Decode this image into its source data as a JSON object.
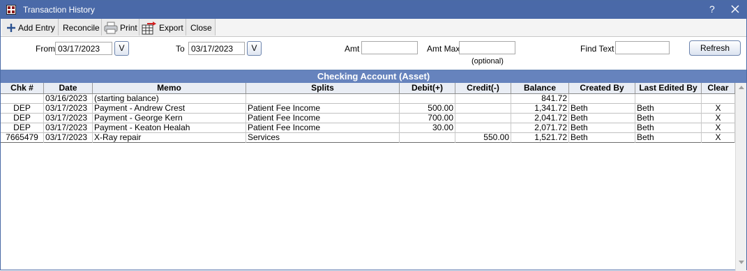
{
  "window": {
    "title": "Transaction History",
    "help_label": "?"
  },
  "toolbar": {
    "add_entry": "Add Entry",
    "reconcile": "Reconcile",
    "print": "Print",
    "export": "Export",
    "close": "Close"
  },
  "filters": {
    "from_label": "From",
    "from_value": "03/17/2023",
    "to_label": "To",
    "to_value": "03/17/2023",
    "v_label": "V",
    "amt_label": "Amt",
    "amt_value": "",
    "amt_max_label": "Amt Max",
    "amt_max_value": "",
    "optional_note": "(optional)",
    "find_text_label": "Find Text",
    "find_text_value": "",
    "refresh_label": "Refresh"
  },
  "grid": {
    "title": "Checking Account (Asset)",
    "columns": [
      "Chk #",
      "Date",
      "Memo",
      "Splits",
      "Debit(+)",
      "Credit(-)",
      "Balance",
      "Created By",
      "Last Edited By",
      "Clear"
    ],
    "rows": [
      [
        "",
        "03/16/2023",
        "(starting balance)",
        "",
        "",
        "",
        "841.72",
        "",
        "",
        ""
      ],
      [
        "DEP",
        "03/17/2023",
        "Payment - Andrew Crest",
        "Patient Fee Income",
        "500.00",
        "",
        "1,341.72",
        "Beth",
        "Beth",
        "X"
      ],
      [
        "DEP",
        "03/17/2023",
        "Payment - George Kern",
        "Patient Fee Income",
        "700.00",
        "",
        "2,041.72",
        "Beth",
        "Beth",
        "X"
      ],
      [
        "DEP",
        "03/17/2023",
        "Payment - Keaton Healah",
        "Patient Fee Income",
        "30.00",
        "",
        "2,071.72",
        "Beth",
        "Beth",
        "X"
      ],
      [
        "7665479",
        "03/17/2023",
        "X-Ray repair",
        "Services",
        "",
        "550.00",
        "1,521.72",
        "Beth",
        "Beth",
        "X"
      ]
    ]
  },
  "colors": {
    "title_bar": "#4a69a8",
    "grid_title": "#6683bd"
  }
}
